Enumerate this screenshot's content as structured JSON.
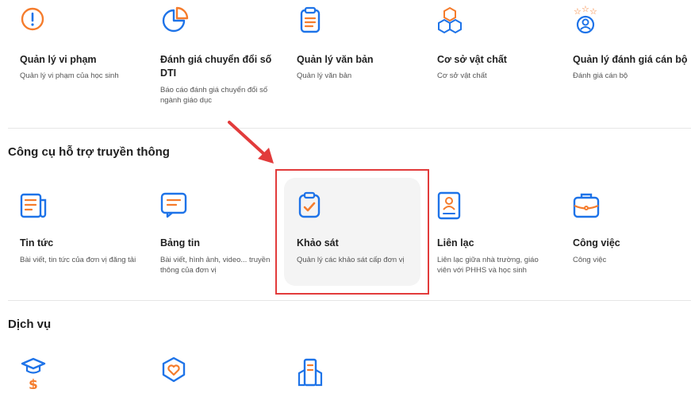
{
  "top_row": [
    {
      "title": "Quản lý vi phạm",
      "desc": "Quản lý vi phạm của học sinh",
      "icon": "alert-circle-icon"
    },
    {
      "title": "Đánh giá chuyển đổi số DTI",
      "desc": "Báo cáo đánh giá chuyển đổi số ngành giáo dục",
      "icon": "pie-chart-icon"
    },
    {
      "title": "Quản lý văn bản",
      "desc": "Quản lý văn bản",
      "icon": "clipboard-document-icon"
    },
    {
      "title": "Cơ sở vật chất",
      "desc": "Cơ sở vật chất",
      "icon": "cubes-icon"
    },
    {
      "title": "Quản lý đánh giá cán bộ",
      "desc": "Đánh giá cán bộ",
      "icon": "user-stars-icon"
    }
  ],
  "section_communication": {
    "title": "Công cụ hỗ trợ truyền thông",
    "items": [
      {
        "title": "Tin tức",
        "desc": "Bài viết, tin tức của đơn vị đăng tải",
        "icon": "newspaper-icon"
      },
      {
        "title": "Bảng tin",
        "desc": "Bài viết, hình ảnh, video... truyền thông của đơn vị",
        "icon": "message-board-icon"
      },
      {
        "title": "Khảo sát",
        "desc": "Quản lý các khảo sát cấp đơn vị",
        "icon": "clipboard-check-icon"
      },
      {
        "title": "Liên lạc",
        "desc": "Liên lạc giữa nhà trường, giáo viên với PHHS và học sinh",
        "icon": "contact-card-icon"
      },
      {
        "title": "Công việc",
        "desc": "Công việc",
        "icon": "briefcase-icon"
      }
    ]
  },
  "section_services": {
    "title": "Dịch vụ",
    "items": [
      {
        "icon": "graduation-dollar-icon"
      },
      {
        "icon": "heart-hands-icon"
      },
      {
        "icon": "buildings-icon"
      }
    ]
  },
  "colors": {
    "accent": "#1e73e8",
    "orange": "#f57c2c",
    "highlight_border": "#e23b3b",
    "arrow": "#e23b3b"
  }
}
